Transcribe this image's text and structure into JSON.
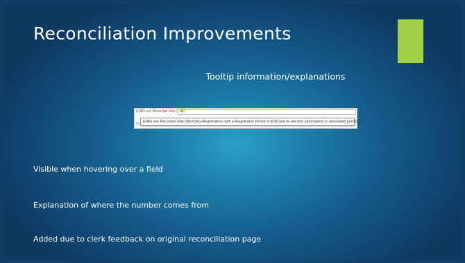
{
  "slide": {
    "title": "Reconciliation Improvements",
    "subtitle": "Tooltip information/explanations",
    "accent_color": "#a1d146",
    "bullets": [
      "Visible when hovering over a field",
      "Explanation of where the number comes from",
      "Added due to clerk feedback on original reconciliation page"
    ]
  },
  "screenshot": {
    "field_label": "EDRs w/o Recorded Vote (WisVote)",
    "lock_icon": "lock-icon",
    "field_value": "0",
    "row_stub": "EDR",
    "tooltip_text": "EDRs w/o Recorded Vote (WisVote)–Registrations with a Registration Period of EDR and no election participation in associated poll book"
  }
}
